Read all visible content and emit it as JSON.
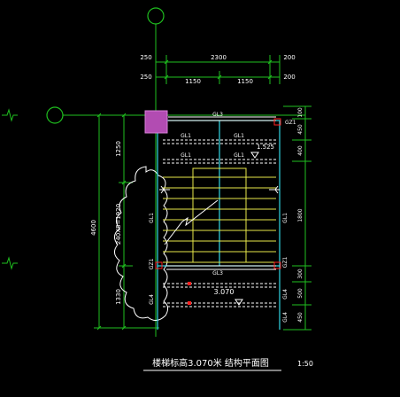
{
  "drawing": {
    "title": "楼梯标高3.070米 结构平面图",
    "scale": "1:50",
    "colors": {
      "background": "#000000",
      "green": "#1fbf1f",
      "yellow": "#e8e84a",
      "cyan": "#33d9e6",
      "white": "#ffffff",
      "red": "#ff2020",
      "magenta": "#b24cb2"
    }
  },
  "dimensions": {
    "top_row1": [
      "250",
      "2300",
      "200"
    ],
    "top_row2": [
      "250",
      "1150",
      "1150",
      "200"
    ],
    "left_inner": [
      "1250",
      "240X8=1920",
      "1330"
    ],
    "left_outer": "4600",
    "right": [
      "100",
      "450",
      "400",
      "1800",
      "300",
      "500",
      "450"
    ]
  },
  "labels": {
    "gl3_top": "GL3",
    "gl1_a": "GL1",
    "gl1_b": "GL1",
    "gl1_c": "GL1",
    "gl1_d": "GL1",
    "gl3_mid": "GL3",
    "gl1_vert_left": "GL1",
    "gl1_vert_right": "GL1",
    "gl2": "GL2",
    "gl4": "GL4",
    "gz1_tr": "GZ1",
    "gz1_r": "GZ1",
    "gz1_l": "GZ1",
    "gl4_r": "GL4",
    "gl4_r2": "GL4",
    "level_mid": "1.525",
    "level_low": "3.070"
  }
}
